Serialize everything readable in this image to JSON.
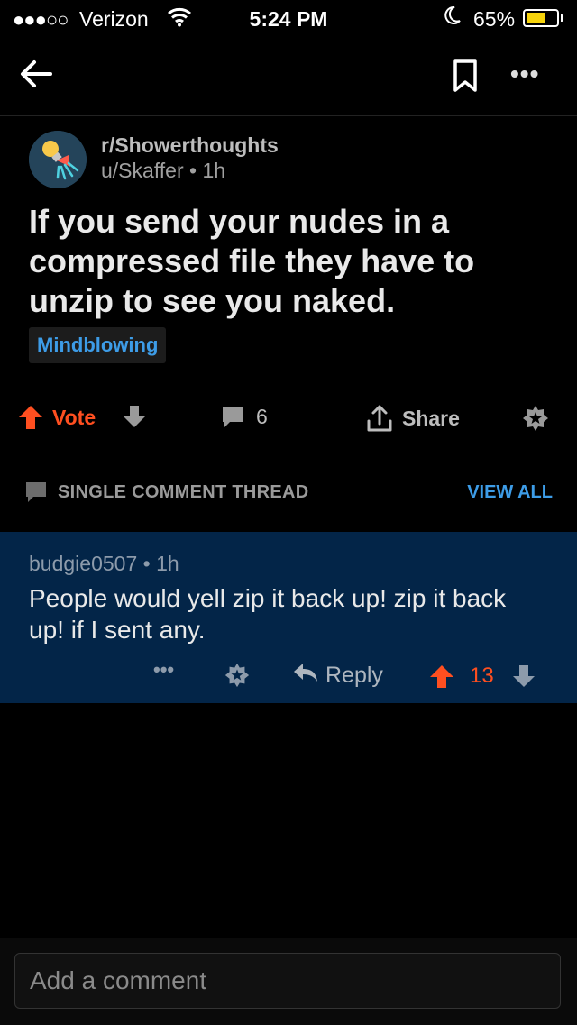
{
  "status_bar": {
    "signal": "●●●○○",
    "carrier": "Verizon",
    "time": "5:24 PM",
    "battery_percent": "65%",
    "battery_level": 0.65
  },
  "nav": {
    "back_icon": "arrow-left-icon",
    "bookmark_icon": "bookmark-icon",
    "more_label": "•••"
  },
  "post": {
    "subreddit": "r/Showerthoughts",
    "author": "u/Skaffer",
    "separator": "•",
    "age": "1h",
    "title": "If you send your nudes in a compressed file they have to unzip to see you naked.",
    "flair": "Mindblowing",
    "vote_label": "Vote",
    "comment_count": "6",
    "share_label": "Share"
  },
  "thread": {
    "label": "SINGLE COMMENT THREAD",
    "view_all": "VIEW ALL"
  },
  "comment": {
    "author": "budgie0507",
    "separator": "•",
    "age": "1h",
    "body": "People would yell zip it back up! zip it back up! if I sent any.",
    "more_label": "•••",
    "reply_label": "Reply",
    "score": "13"
  },
  "composer": {
    "placeholder": "Add a comment"
  },
  "colors": {
    "upvote": "#ff4f20",
    "link": "#3d9ce7",
    "comment_bg": "#032548",
    "battery": "#f6d30b"
  }
}
